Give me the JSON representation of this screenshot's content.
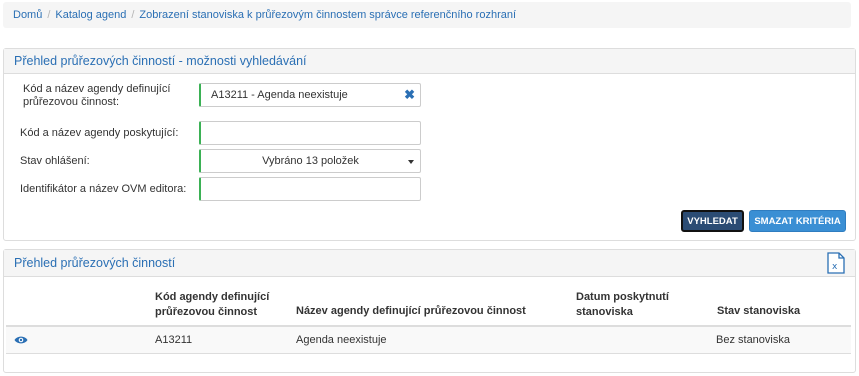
{
  "breadcrumb": {
    "items": [
      "Domů",
      "Katalog agend",
      "Zobrazení stanoviska k průřezovým činnostem správce referenčního rozhraní"
    ]
  },
  "search": {
    "title": "Přehled průřezových činností - možnosti vyhledávání",
    "fields": [
      {
        "label": "Kód a název agendy definující průřezovou činnost:",
        "value": "A13211 - Agenda neexistuje"
      },
      {
        "label": "Kód a název agendy poskytující:",
        "value": ""
      },
      {
        "label": "Stav ohlášení:",
        "value": "Vybráno 13 položek"
      },
      {
        "label": "Identifikátor a název OVM editora:",
        "value": ""
      }
    ],
    "search_button": "VYHLEDAT",
    "clear_button": "SMAZAT KRITÉRIA"
  },
  "results": {
    "title": "Přehled průřezových činností",
    "columns": [
      "Kód agendy definující průřezovou činnost",
      "Název agendy definující průřezovou činnost",
      "Datum poskytnutí stanoviska",
      "Stav stanoviska"
    ],
    "rows": [
      {
        "code": "A13211",
        "name": "Agenda neexistuje",
        "date": "",
        "status": "Bez stanoviska"
      }
    ]
  },
  "colors": {
    "accent": "#2a6fb4",
    "valid_border": "#3bb155",
    "search_btn": "#2b4c74",
    "clear_btn": "#3a8fd4"
  },
  "icons": {
    "clear": "close-icon",
    "dropdown": "chevron-down-icon",
    "export": "excel-export-icon",
    "detail": "eye-icon"
  }
}
